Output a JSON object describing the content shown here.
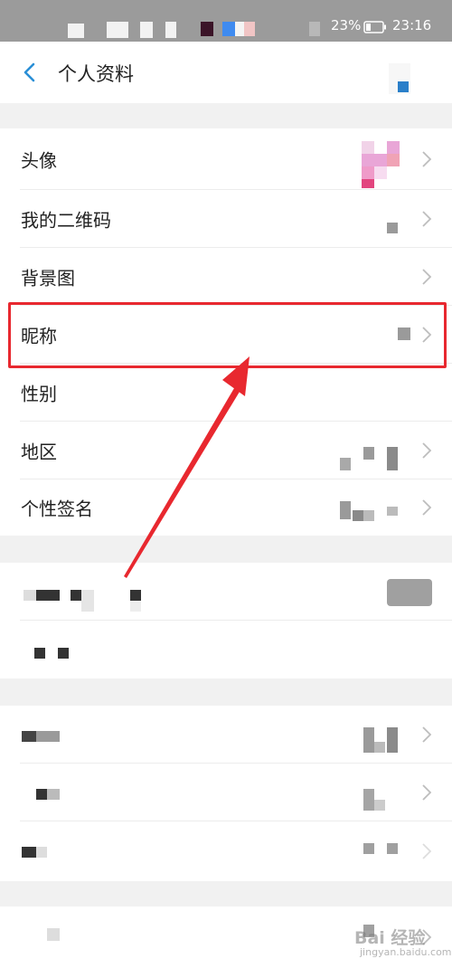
{
  "status_bar": {
    "battery": "23%",
    "time": "23:16"
  },
  "nav": {
    "title": "个人资料"
  },
  "profile_rows": [
    {
      "label": "头像"
    },
    {
      "label": "我的二维码"
    },
    {
      "label": "背景图"
    },
    {
      "label": "昵称"
    },
    {
      "label": "性别"
    },
    {
      "label": "地区"
    },
    {
      "label": "个性签名"
    }
  ],
  "watermark": {
    "text": "Bai 经验",
    "sub": "jingyan.baidu.com"
  },
  "colors": {
    "highlight": "#e8282f",
    "accent": "#2a8fd6",
    "status_bar": "#9b9b9b"
  }
}
